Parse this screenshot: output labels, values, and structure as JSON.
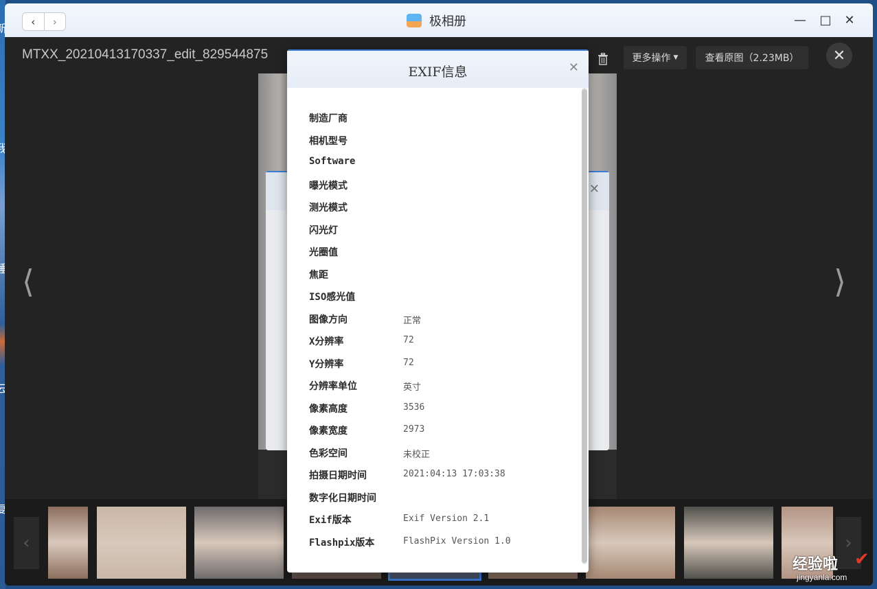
{
  "desktop": {
    "side_chars": [
      "新",
      "我",
      "睡",
      "云",
      "复"
    ]
  },
  "window": {
    "title": "极相册",
    "nav_back": "‹",
    "nav_forward": "›",
    "controls": {
      "minimize": "—",
      "maximize": "□",
      "close": "✕"
    }
  },
  "viewer": {
    "filename": "MTXX_20210413170337_edit_829544875",
    "more_actions": "更多操作",
    "view_original": "查看原图（2.23MB）",
    "close": "✕",
    "prev_arrow": "⟨",
    "next_arrow": "⟩"
  },
  "exif_dialog": {
    "title": "EXIF信息",
    "close": "✕",
    "rows": [
      {
        "label": "制造厂商",
        "value": ""
      },
      {
        "label": "相机型号",
        "value": ""
      },
      {
        "label": "Software",
        "value": ""
      },
      {
        "label": "曝光模式",
        "value": ""
      },
      {
        "label": "测光模式",
        "value": ""
      },
      {
        "label": "闪光灯",
        "value": ""
      },
      {
        "label": "光圈值",
        "value": ""
      },
      {
        "label": "焦距",
        "value": ""
      },
      {
        "label": "ISO感光值",
        "value": ""
      },
      {
        "label": "图像方向",
        "value": "正常"
      },
      {
        "label": "X分辨率",
        "value": "72"
      },
      {
        "label": "Y分辨率",
        "value": "72"
      },
      {
        "label": "分辨率单位",
        "value": "英寸"
      },
      {
        "label": "像素高度",
        "value": "3536"
      },
      {
        "label": "像素宽度",
        "value": "2973"
      },
      {
        "label": "色彩空间",
        "value": "未校正"
      },
      {
        "label": "拍摄日期时间",
        "value": "2021:04:13 17:03:38"
      },
      {
        "label": "数字化日期时间",
        "value": ""
      },
      {
        "label": "Exif版本",
        "value": "Exif Version 2.1"
      },
      {
        "label": "Flashpix版本",
        "value": "FlashPix Version 1.0"
      }
    ]
  },
  "filmstrip": {
    "prev": "‹",
    "next": "›",
    "thumbnails": [
      {
        "name": "photo-1",
        "color": "#8c6e5e"
      },
      {
        "name": "photo-2",
        "color": "#c9b8a8"
      },
      {
        "name": "photo-3",
        "color": "#6f6b6c"
      },
      {
        "name": "photo-4",
        "color": "#5a4a44"
      },
      {
        "name": "photo-5",
        "color": "#3e4a63"
      },
      {
        "name": "photo-6",
        "color": "#7e6456"
      },
      {
        "name": "photo-7",
        "color": "#a68873"
      },
      {
        "name": "photo-8",
        "color": "#50514c"
      },
      {
        "name": "photo-9",
        "color": "#b39484"
      }
    ]
  },
  "watermark": {
    "text": "经验啦",
    "url": "jingyanla.com",
    "check": "✔"
  }
}
